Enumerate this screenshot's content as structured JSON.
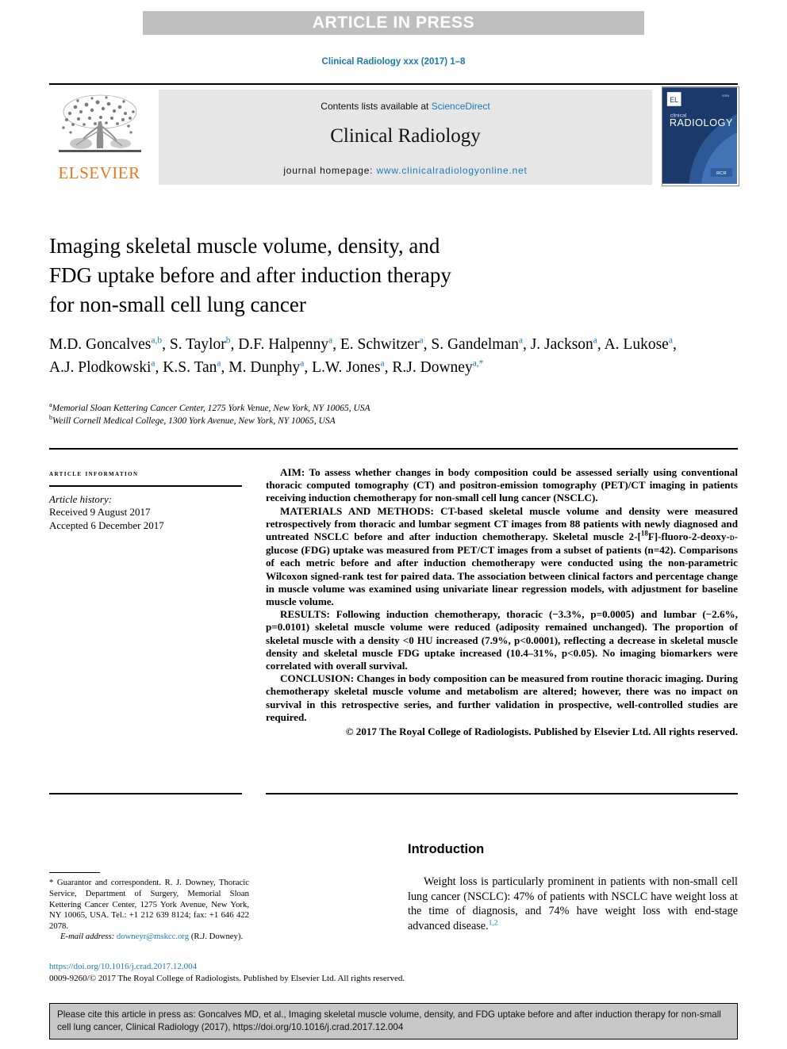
{
  "banner": {
    "label": "ARTICLE IN PRESS"
  },
  "running_head": "Clinical Radiology xxx (2017) 1–8",
  "masthead": {
    "publisher_name": "ELSEVIER",
    "contents_prefix": "Contents lists available at ",
    "contents_link": "ScienceDirect",
    "journal_name": "Clinical Radiology",
    "homepage_label": "journal homepage: ",
    "homepage_url": "www.clinicalradiologyonline.net",
    "cover_title_small": "clinical",
    "cover_title_large": "RADIOLOGY",
    "link_color": "#1a7ab5",
    "elsevier_orange": "#E87722"
  },
  "article": {
    "title_line1": "Imaging skeletal muscle volume, density, and",
    "title_line2": "FDG uptake before and after induction therapy",
    "title_line3": "for non-small cell lung cancer",
    "authors": [
      {
        "name": "M.D. Goncalves",
        "marks": "a,b",
        "sep": ", "
      },
      {
        "name": "S. Taylor",
        "marks": "b",
        "sep": ", "
      },
      {
        "name": "D.F. Halpenny",
        "marks": "a",
        "sep": ", "
      },
      {
        "name": "E. Schwitzer",
        "marks": "a",
        "sep": ", "
      },
      {
        "name": "S. Gandelman",
        "marks": "a",
        "sep": ", "
      },
      {
        "name": "J. Jackson",
        "marks": "a",
        "sep": ", "
      },
      {
        "name": "A. Lukose",
        "marks": "a",
        "sep": ", "
      },
      {
        "name": "A.J. Plodkowski",
        "marks": "a",
        "sep": ", "
      },
      {
        "name": "K.S. Tan",
        "marks": "a",
        "sep": ", "
      },
      {
        "name": "M. Dunphy",
        "marks": "a",
        "sep": ", "
      },
      {
        "name": "L.W. Jones",
        "marks": "a",
        "sep": ", "
      },
      {
        "name": "R.J. Downey",
        "marks": "a,*",
        "sep": ""
      }
    ],
    "affiliations": [
      {
        "mark": "a",
        "text": "Memorial Sloan Kettering Cancer Center, 1275 York Venue, New York, NY 10065, USA"
      },
      {
        "mark": "b",
        "text": "Weill Cornell Medical College, 1300 York Avenue, New York, NY 10065, USA"
      }
    ]
  },
  "article_information": {
    "heading": "ARTICLE INFORMATION",
    "history_label": "Article history:",
    "received": "Received 9 August 2017",
    "accepted": "Accepted 6 December 2017"
  },
  "abstract": {
    "aim_label": "AIM:",
    "aim_text": " To assess whether changes in body composition could be assessed serially using conventional thoracic computed tomography (CT) and positron-emission tomography (PET)/CT imaging in patients receiving induction chemotherapy for non-small cell lung cancer (NSCLC).",
    "methods_label": "MATERIALS AND METHODS:",
    "methods_text_a": " CT-based skeletal muscle volume and density were measured retrospectively from thoracic and lumbar segment CT images from 88 patients with newly diagnosed and untreated NSCLC before and after induction chemotherapy. Skeletal muscle 2-[",
    "methods_sup": "18",
    "methods_text_b": "F]-fluoro-2-deoxy-",
    "methods_smallcap": "d",
    "methods_text_c": "-glucose (FDG) uptake was measured from PET/CT images from a subset of patients (n=42). Comparisons of each metric before and after induction chemotherapy were conducted using the non-parametric Wilcoxon signed-rank test for paired data. The association between clinical factors and percentage change in muscle volume was examined using univariate linear regression models, with adjustment for baseline muscle volume.",
    "results_label": "RESULTS:",
    "results_text": " Following induction chemotherapy, thoracic (−3.3%, p=0.0005) and lumbar (−2.6%, p=0.0101) skeletal muscle volume were reduced (adiposity remained unchanged). The proportion of skeletal muscle with a density <0 HU increased (7.9%, p<0.0001), reflecting a decrease in skeletal muscle density and skeletal muscle FDG uptake increased (10.4–31%, p<0.05). No imaging biomarkers were correlated with overall survival.",
    "conclusion_label": "CONCLUSION:",
    "conclusion_text": " Changes in body composition can be measured from routine thoracic imaging. During chemotherapy skeletal muscle volume and metabolism are altered; however, there was no impact on survival in this retrospective series, and further validation in prospective, well-controlled studies are required.",
    "copyright": "© 2017 The Royal College of Radiologists. Published by Elsevier Ltd. All rights reserved."
  },
  "footnote": {
    "correspondence": "* Guarantor and correspondent. R. J. Downey, Thoracic Service, Department of Surgery, Memorial Sloan Kettering Cancer Center, 1275 York Avenue, New York, NY 10065, USA. Tel.: +1 212 639 8124; fax: +1 646 422 2078.",
    "email_label": "E-mail address: ",
    "email": "downeyr@mskcc.org",
    "email_suffix": " (R.J. Downey)."
  },
  "doi_block": {
    "doi_url": "https://doi.org/10.1016/j.crad.2017.12.004",
    "issn_line": "0009-9260/© 2017 The Royal College of Radiologists. Published by Elsevier Ltd. All rights reserved."
  },
  "introduction": {
    "heading": "Introduction",
    "paragraph_a": "Weight loss is particularly prominent in patients with non-small cell lung cancer (NSCLC): 47% of patients with NSCLC have weight loss at the time of diagnosis, and 74% have weight loss with end-stage advanced disease.",
    "citation_sup": "1,2"
  },
  "citation_footer": {
    "text": "Please cite this article in press as: Goncalves MD, et al., Imaging skeletal muscle volume, density, and FDG uptake before and after induction therapy for non-small cell lung cancer, Clinical Radiology (2017), https://doi.org/10.1016/j.crad.2017.12.004"
  }
}
